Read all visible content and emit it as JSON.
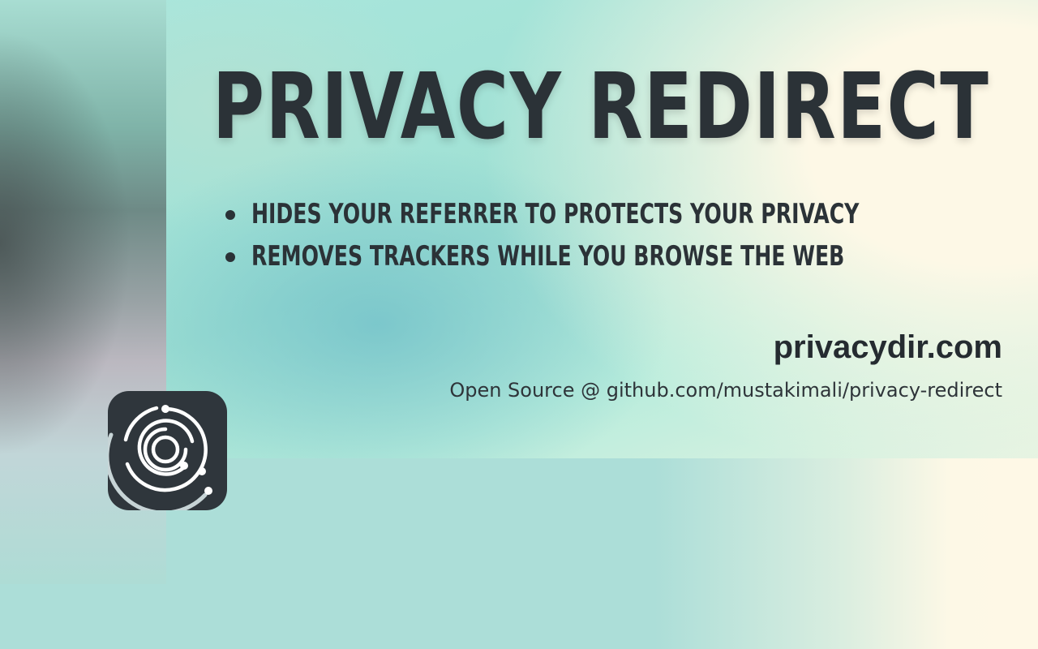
{
  "banner": {
    "title": "PRIVACY REDIRECT",
    "features": [
      "HIDES YOUR REFERRER TO PROTECTS YOUR PRIVACY",
      "REMOVES TRACKERS WHILE YOU BROWSE THE WEB"
    ],
    "website": "privacydir.com",
    "source_text": "Open Source @  github.com/mustakimali/privacy-redirect"
  },
  "logo": {
    "icon": "orbit-rings-icon"
  },
  "colors": {
    "text_dark": "#2b3237",
    "logo_bg": "#2f363c",
    "teal_bg": "#acded8",
    "cream": "#fdf8e6"
  }
}
